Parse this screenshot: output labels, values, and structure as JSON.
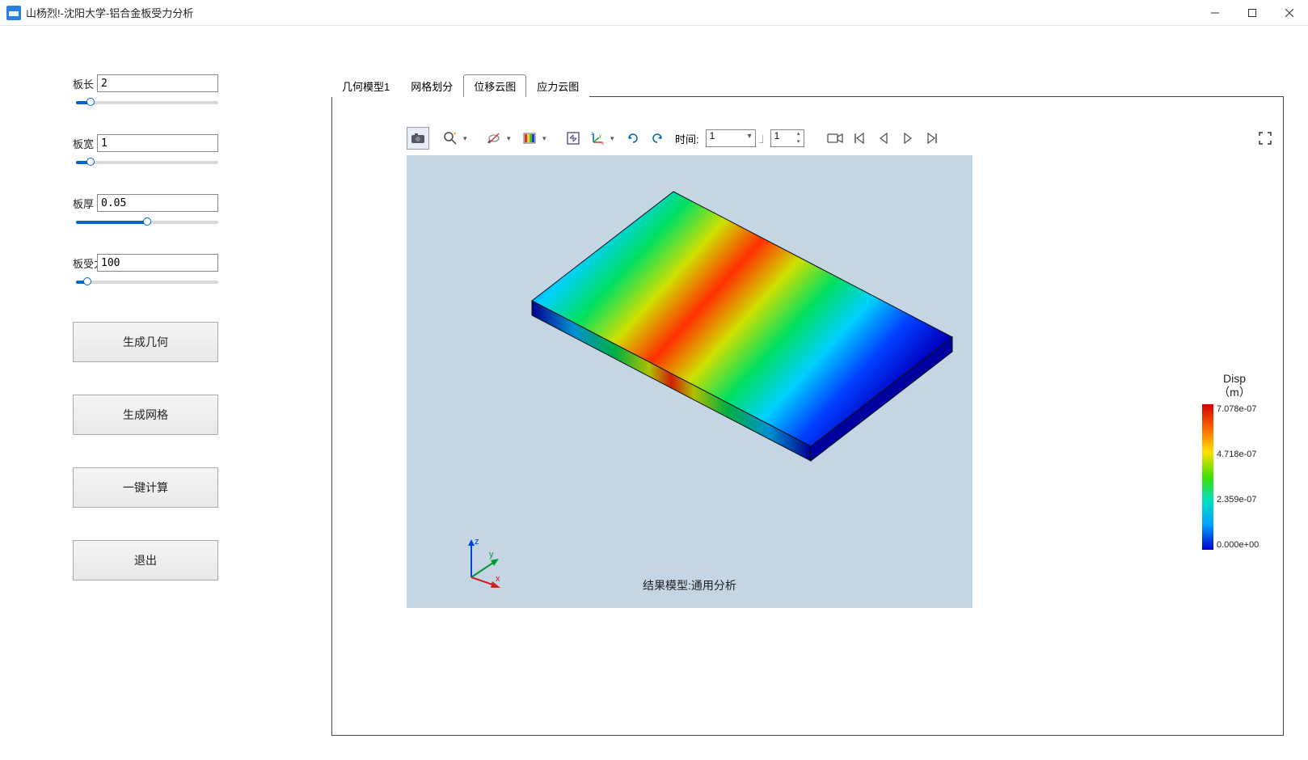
{
  "window": {
    "title": "山杨烈!-沈阳大学-铝合金板受力分析"
  },
  "params": {
    "length_label": "板长",
    "length_value": "2",
    "width_label": "板宽",
    "width_value": "1",
    "thick_label": "板厚",
    "thick_value": "0.05",
    "force_label": "板受力",
    "force_value": "100"
  },
  "buttons": {
    "generate_geometry": "生成几何",
    "generate_mesh": "生成网格",
    "compute": "一键计算",
    "exit": "退出"
  },
  "tabs": {
    "geom": "几何模型1",
    "mesh": "网格划分",
    "disp": "位移云图",
    "stress": "应力云图",
    "active": "disp"
  },
  "toolbar": {
    "time_label": "时间:",
    "combo_value": "1",
    "spin_value": "1"
  },
  "result": {
    "title": "结果模型:通用分析",
    "legend_title1": "Disp",
    "legend_title2": "（m）",
    "legend_max": "7.078e-07",
    "legend_mid1": "4.718e-07",
    "legend_mid2": "2.359e-07",
    "legend_min": "0.000e+00"
  },
  "triad": {
    "x": "x",
    "y": "y",
    "z": "z"
  },
  "icons": {
    "camera": "camera-icon",
    "zoom": "zoom-icon",
    "selection_mode": "selection-mode-icon",
    "rainbow": "rainbow-icon",
    "fit": "fit-icon",
    "axes": "axes-icon",
    "rotate_ccw": "rotate-ccw-icon",
    "rotate_cw": "rotate-cw-icon",
    "record": "record-icon",
    "first_frame": "first-frame-icon",
    "prev_frame": "prev-frame-icon",
    "next_frame": "next-frame-icon",
    "last_frame": "last-frame-icon",
    "fullscreen": "fullscreen-icon"
  }
}
